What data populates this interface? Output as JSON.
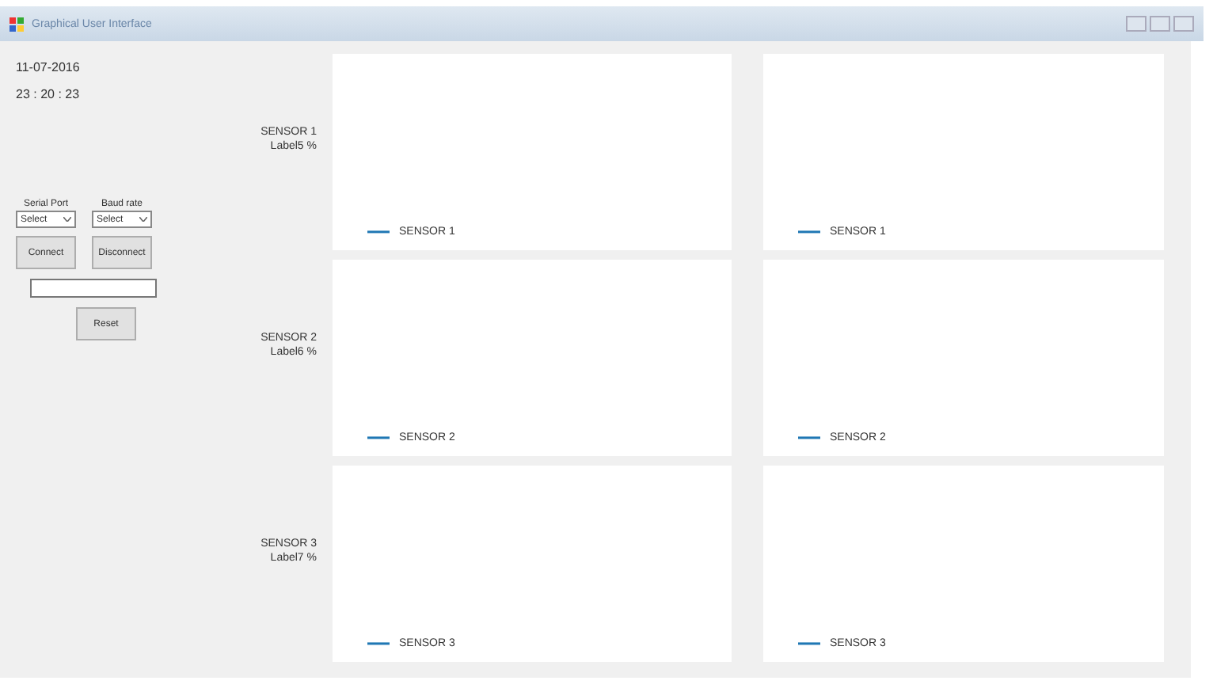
{
  "window": {
    "title": "Graphical User Interface"
  },
  "date": "11-07-2016",
  "time": "23 : 20 : 23",
  "serial_port": {
    "label": "Serial Port",
    "value": "Select"
  },
  "baud_rate": {
    "label": "Baud rate",
    "value": "Select"
  },
  "buttons": {
    "connect": "Connect",
    "disconnect": "Disconnect",
    "reset": "Reset"
  },
  "sensors": [
    {
      "name": "SENSOR 1",
      "label": "Label5 %",
      "charts": [
        {
          "legend": "SENSOR 1",
          "color": "#1f77b4"
        },
        {
          "legend": "SENSOR 1",
          "color": "#1f77b4"
        }
      ]
    },
    {
      "name": "SENSOR 2",
      "label": "Label6 %",
      "charts": [
        {
          "legend": "SENSOR 2",
          "color": "#1f77b4"
        },
        {
          "legend": "SENSOR 2",
          "color": "#1f77b4"
        }
      ]
    },
    {
      "name": "SENSOR 3",
      "label": "Label7 %",
      "charts": [
        {
          "legend": "SENSOR 3",
          "color": "#1f77b4"
        },
        {
          "legend": "SENSOR 3",
          "color": "#1f77b4"
        }
      ]
    }
  ]
}
